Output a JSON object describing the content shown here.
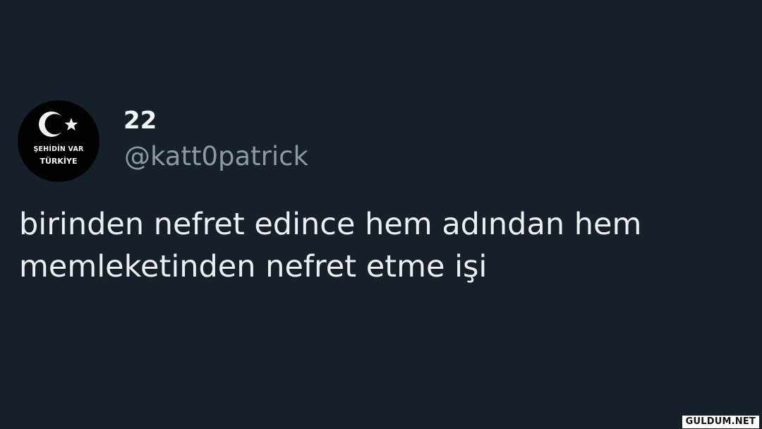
{
  "tweet": {
    "avatar": {
      "line1": "ŞEHİDİN VAR",
      "line2": "TÜRKİYE",
      "icon": "crescent-star-icon"
    },
    "display_name": "22",
    "handle": "@katt0patrick",
    "text_lines": [
      "birinden nefret edince hem adından hem",
      "memleketinden nefret etme işi"
    ]
  },
  "watermark": "GULDUM.NET",
  "colors": {
    "background": "#17202a",
    "text": "#e7e9ea",
    "secondary_text": "#8b98a5"
  }
}
